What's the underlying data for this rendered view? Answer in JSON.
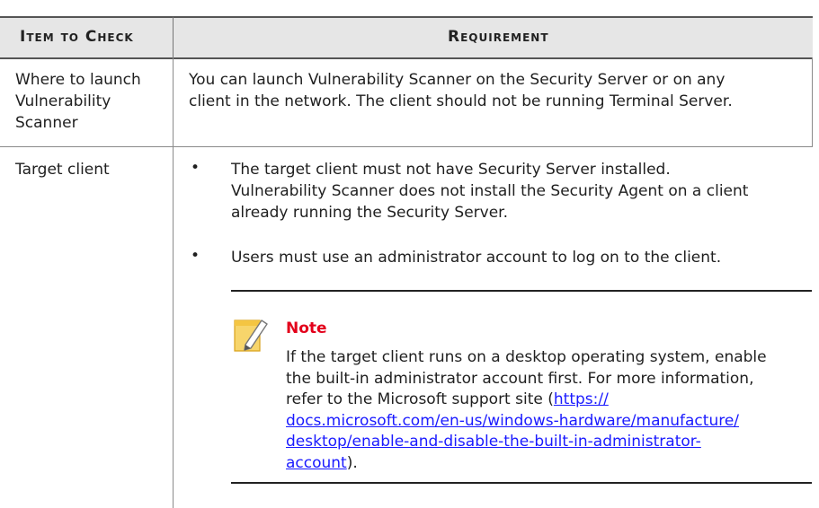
{
  "header": {
    "col1": "Item to Check",
    "col2": "Requirement"
  },
  "rows": [
    {
      "item_line1": "Where to launch",
      "item_line2": "Vulnerability",
      "item_line3": "Scanner",
      "req_line1": "You can launch Vulnerability Scanner on the Security Server or on any",
      "req_line2": "client in the network. The client should not be running Terminal Server."
    },
    {
      "item_line1": "Target client",
      "bullet1_line1": "The target client must not have Security Server installed.",
      "bullet1_line2": "Vulnerability Scanner does not install the Security Agent on a client",
      "bullet1_line3": "already running the Security Server.",
      "bullet2": "Users must use an administrator account to log on to the client."
    }
  ],
  "note": {
    "title": "Note",
    "line1": "If the target client runs on a desktop operating system, enable",
    "line2": "the built-in administrator account first. For more information,",
    "line3_prefix": "refer to the Microsoft support site (",
    "link_part1": "https://",
    "link_part2": "docs.microsoft.com/en-us/windows-hardware/manufacture/",
    "link_part3": "desktop/enable-and-disable-the-built-in-administrator-",
    "link_part4": "account",
    "suffix": ")."
  },
  "colors": {
    "note_title": "#e3001b",
    "link": "#1a1aff",
    "header_bg": "#e6e6e6"
  },
  "icons": {
    "note": "note-pencil-icon"
  }
}
